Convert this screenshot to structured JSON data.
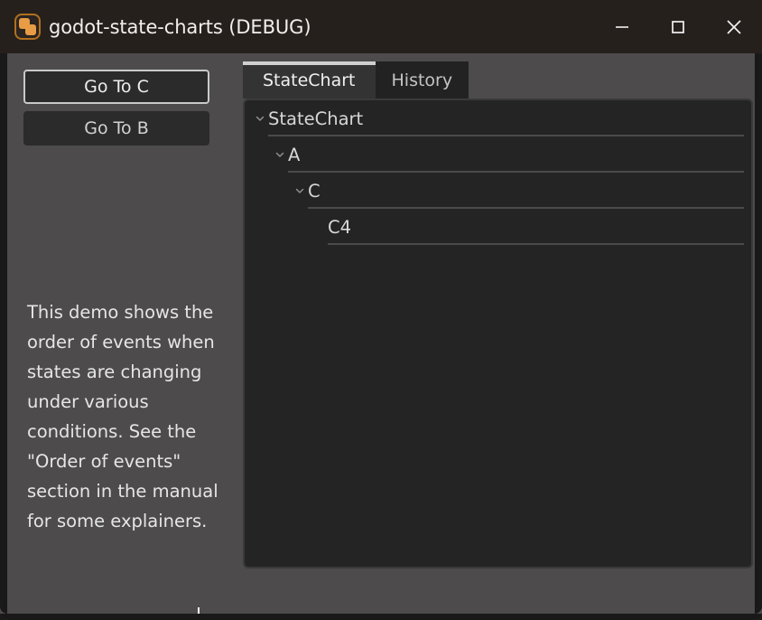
{
  "window": {
    "title": "godot-state-charts (DEBUG)",
    "icon": "godot-state-charts-app-icon",
    "controls": {
      "minimize": "minimize-icon",
      "maximize": "maximize-icon",
      "close": "close-icon"
    },
    "colors": {
      "titlebar_bg": "#26201d",
      "window_bg": "#4d4b4b",
      "panel_bg": "#242424",
      "accent_orange": "#e79c45",
      "tab_active_bg": "#333333",
      "tab_inactive_bg": "#222222",
      "button_bg": "#2b2b2b",
      "focus_border": "#c9c9c9"
    }
  },
  "sidebar": {
    "buttons": [
      {
        "label": "Go To C",
        "focused": true
      },
      {
        "label": "Go To B",
        "focused": false
      }
    ],
    "description": "This demo shows the order of events when states are changing under various conditions. See the \"Order of events\" section in the manual for some explainers."
  },
  "tabs": [
    {
      "label": "StateChart",
      "active": true
    },
    {
      "label": "History",
      "active": false
    }
  ],
  "tree": {
    "rows": [
      {
        "label": "StateChart",
        "level": 0,
        "expanded": true,
        "chevron": "chevron-down-icon"
      },
      {
        "label": "A",
        "level": 1,
        "expanded": true,
        "chevron": "chevron-down-icon"
      },
      {
        "label": "C",
        "level": 2,
        "expanded": true,
        "chevron": "chevron-down-icon"
      },
      {
        "label": "C4",
        "level": 3,
        "expanded": false,
        "chevron": ""
      }
    ]
  }
}
